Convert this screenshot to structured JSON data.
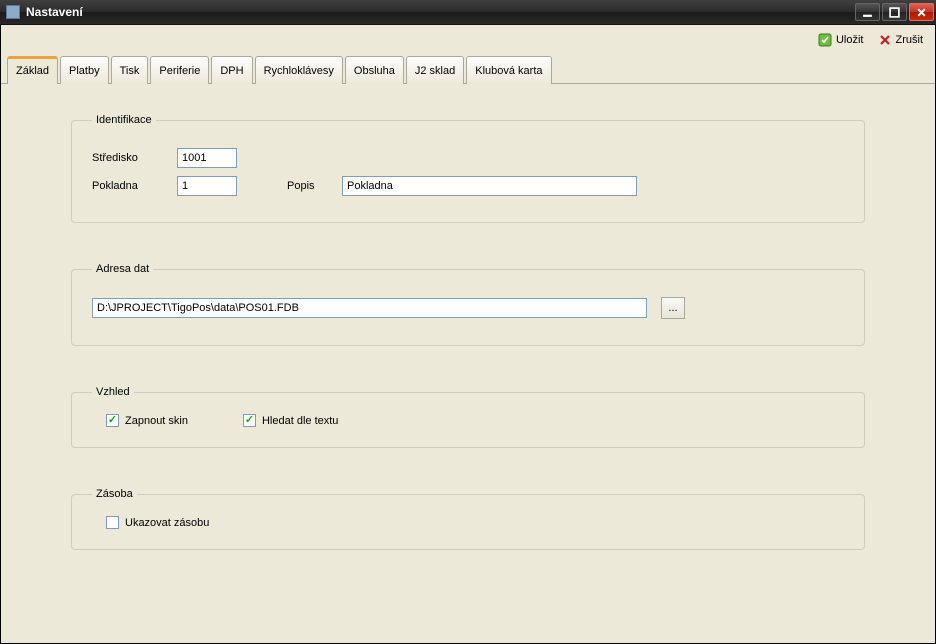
{
  "window": {
    "title": "Nastavení"
  },
  "toolbar": {
    "save": "Uložit",
    "cancel": "Zrušit"
  },
  "tabs": [
    "Základ",
    "Platby",
    "Tisk",
    "Periferie",
    "DPH",
    "Rychloklávesy",
    "Obsluha",
    "J2 sklad",
    "Klubová karta"
  ],
  "sections": {
    "identifikace": {
      "legend": "Identifikace",
      "stredisko_label": "Středisko",
      "stredisko_value": "1001",
      "pokladna_label": "Pokladna",
      "pokladna_value": "1",
      "popis_label": "Popis",
      "popis_value": "Pokladna"
    },
    "adresa": {
      "legend": "Adresa dat",
      "path": "D:\\JPROJECT\\TigoPos\\data\\POS01.FDB",
      "browse": "..."
    },
    "vzhled": {
      "legend": "Vzhled",
      "skin_label": "Zapnout skin",
      "skin_checked": true,
      "hledat_label": "Hledat dle textu",
      "hledat_checked": true
    },
    "zasoba": {
      "legend": "Zásoba",
      "ukazovat_label": "Ukazovat zásobu",
      "ukazovat_checked": false
    }
  }
}
